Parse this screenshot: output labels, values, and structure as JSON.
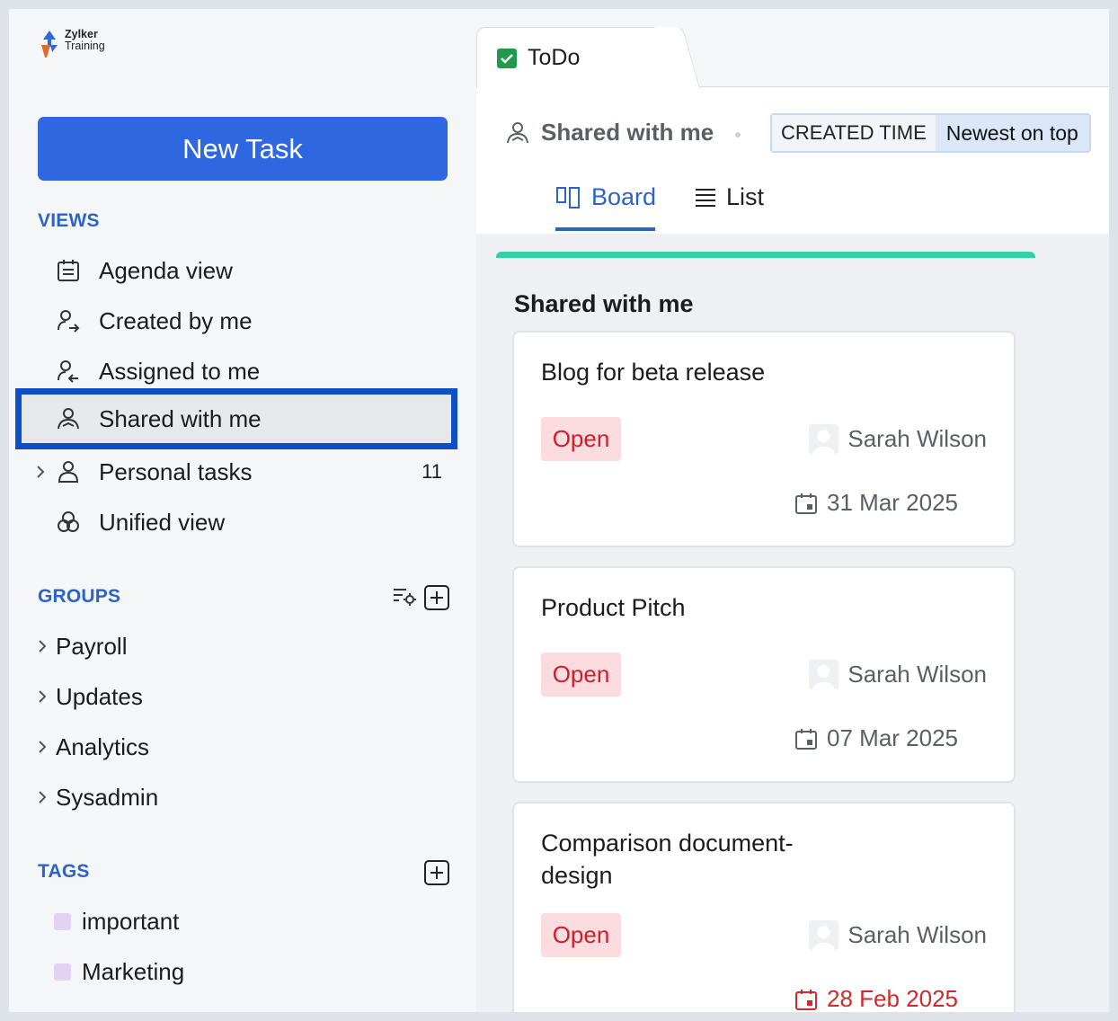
{
  "app": {
    "logo_line1": "Zylker",
    "logo_line2": "Training"
  },
  "sidebar": {
    "new_task_label": "New Task",
    "views_title": "VIEWS",
    "views": [
      {
        "label": "Agenda view",
        "icon": "agenda-icon"
      },
      {
        "label": "Created by me",
        "icon": "user-outgoing-icon"
      },
      {
        "label": "Assigned to me",
        "icon": "user-incoming-icon"
      },
      {
        "label": "Shared with me",
        "icon": "user-shared-icon",
        "active": true
      },
      {
        "label": "Personal tasks",
        "icon": "user-icon",
        "count": "11"
      },
      {
        "label": "Unified view",
        "icon": "unified-circles-icon"
      }
    ],
    "groups_title": "GROUPS",
    "groups": [
      {
        "label": "Payroll"
      },
      {
        "label": "Updates"
      },
      {
        "label": "Analytics"
      },
      {
        "label": "Sysadmin"
      }
    ],
    "tags_title": "TAGS",
    "tags": [
      {
        "label": "important",
        "color": "#e2d3f3"
      },
      {
        "label": "Marketing",
        "color": "#e2d3f3"
      }
    ]
  },
  "main": {
    "tab_label": "ToDo",
    "view_title": "Shared with me",
    "sort_key": "CREATED TIME",
    "sort_value": "Newest on top",
    "view_tabs": {
      "board": "Board",
      "list": "List"
    },
    "column": {
      "title": "Shared with me",
      "accent": "#2fd3a5",
      "cards": [
        {
          "title": "Blog for beta release",
          "status": "Open",
          "owner": "Sarah Wilson",
          "due": "31 Mar 2025",
          "overdue": false
        },
        {
          "title": "Product Pitch",
          "status": "Open",
          "owner": "Sarah Wilson",
          "due": "07 Mar 2025",
          "overdue": false
        },
        {
          "title": "Comparison document-design",
          "status": "Open",
          "owner": "Sarah Wilson",
          "due": "28 Feb 2025",
          "overdue": true
        }
      ]
    }
  },
  "colors": {
    "primary": "#2e67df",
    "accent_blue": "#2d63c7",
    "status_open_bg": "#fcdcdf",
    "status_open_text": "#cf1d2c",
    "overdue": "#d12a2a"
  }
}
